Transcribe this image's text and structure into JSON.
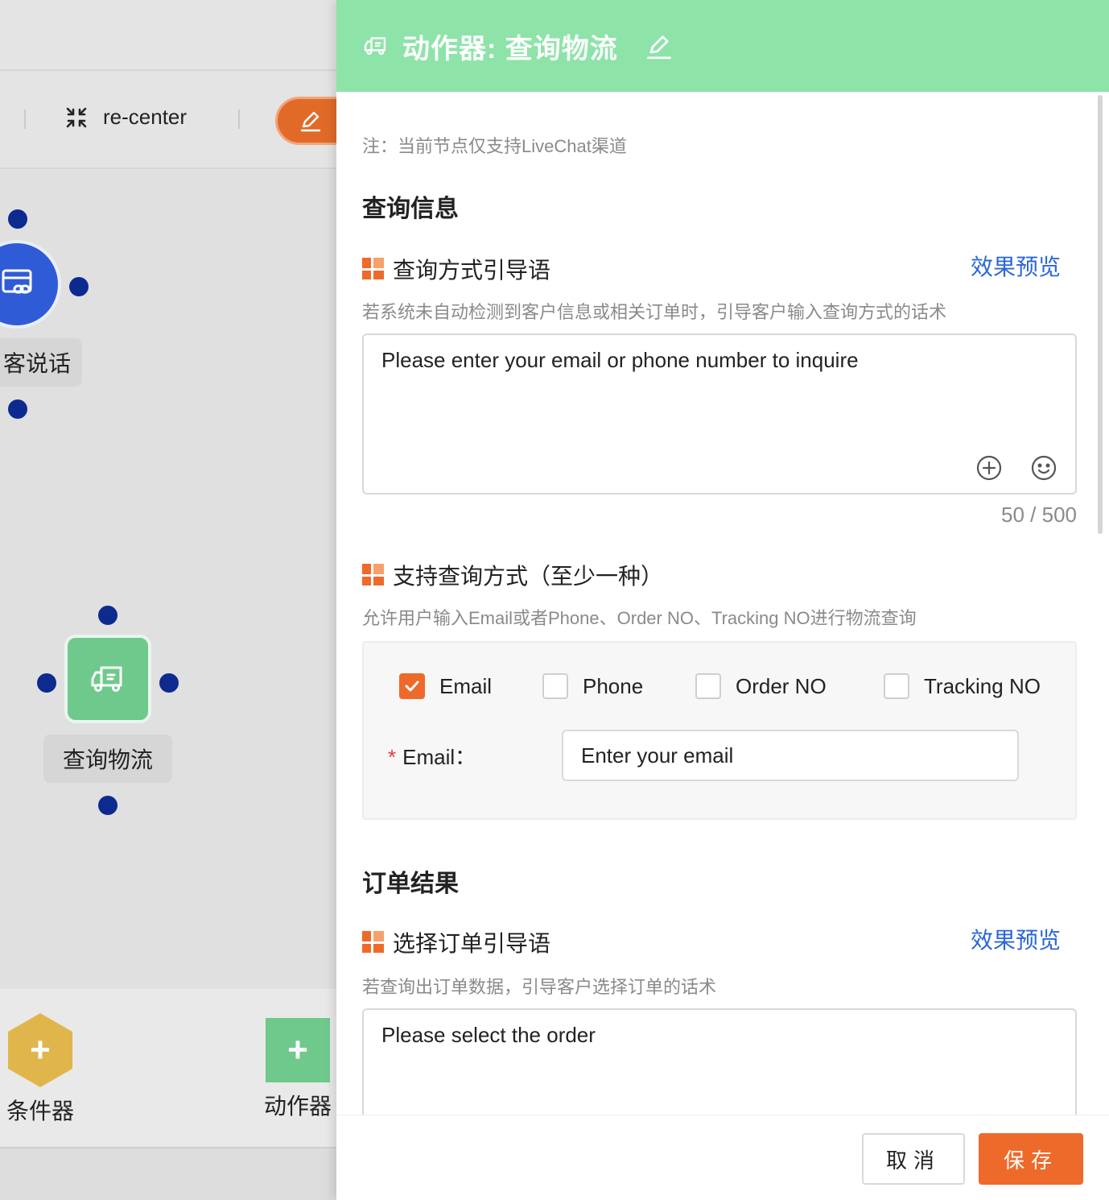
{
  "canvas": {
    "toolbar": {
      "recenter_label": "re-center"
    },
    "start_node": {
      "label": "客说话"
    },
    "logistics_node": {
      "label": "查询物流"
    },
    "palette": {
      "condition_label": "条件器",
      "action_label": "动作器",
      "plus": "+"
    }
  },
  "panel": {
    "title": "动作器: 查询物流",
    "note": "注：当前节点仅支持LiveChat渠道",
    "query_section": {
      "title": "查询信息",
      "guide": {
        "title": "查询方式引导语",
        "preview_label": "效果预览",
        "description": "若系统未自动检测到客户信息或相关订单时，引导客户输入查询方式的话术",
        "value": "Please enter your email or phone number to inquire",
        "counter": "50 / 500"
      },
      "methods": {
        "title": "支持查询方式（至少一种）",
        "description": "允许用户输入Email或者Phone、Order NO、Tracking NO进行物流查询",
        "options": [
          {
            "label": "Email",
            "checked": true
          },
          {
            "label": "Phone",
            "checked": false
          },
          {
            "label": "Order NO",
            "checked": false
          },
          {
            "label": "Tracking NO",
            "checked": false
          }
        ],
        "email_field": {
          "required_mark": "*",
          "label": "Email：",
          "placeholder": "Enter your email"
        }
      }
    },
    "order_section": {
      "title": "订单结果",
      "guide": {
        "title": "选择订单引导语",
        "preview_label": "效果预览",
        "description": "若查询出订单数据，引导客户选择订单的话术",
        "value": "Please select the order"
      }
    },
    "footer": {
      "cancel_label": "取消",
      "save_label": "保存"
    }
  },
  "colors": {
    "header_green": "#8ee3a9",
    "accent_orange": "#ee6a2a",
    "link_blue": "#2b66d9",
    "node_blue": "#2f5bd6",
    "node_green": "#6fc98d",
    "port_navy": "#0d2a8f",
    "condition_yellow": "#e0b64c"
  },
  "icons": {
    "recenter": "compress-arrows-icon",
    "edit": "pencil-icon",
    "truck": "truck-icon",
    "start": "chat-link-icon",
    "add": "plus-circle-icon",
    "emoji": "smiley-icon",
    "field": "grid-icon"
  }
}
